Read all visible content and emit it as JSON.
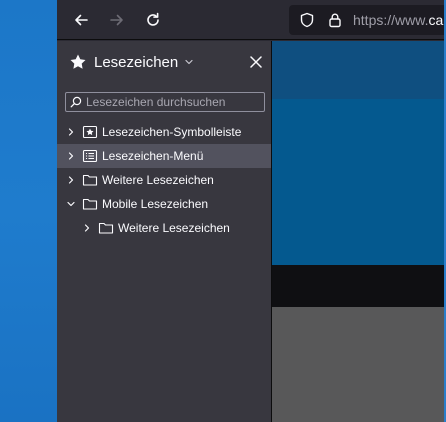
{
  "toolbar": {
    "back_icon": "arrow-left-icon",
    "forward_icon": "arrow-right-icon",
    "reload_icon": "reload-icon",
    "url_prefix": "https://www.",
    "url_domain": "car"
  },
  "sidebar": {
    "title": "Lesezeichen",
    "search_placeholder": "Lesezeichen durchsuchen",
    "items": [
      {
        "label": "Lesezeichen-Symbolleiste",
        "icon": "bookmark-toolbar-icon",
        "expanded": false,
        "depth": 0
      },
      {
        "label": "Lesezeichen-Menü",
        "icon": "bookmark-menu-icon",
        "expanded": false,
        "depth": 0,
        "selected": true
      },
      {
        "label": "Weitere Lesezeichen",
        "icon": "folder-icon",
        "expanded": false,
        "depth": 0
      },
      {
        "label": "Mobile Lesezeichen",
        "icon": "folder-icon",
        "expanded": true,
        "depth": 0
      },
      {
        "label": "Weitere Lesezeichen",
        "icon": "folder-icon",
        "expanded": false,
        "depth": 1
      }
    ]
  },
  "colors": {
    "toolbar_bg": "#2b2a33",
    "sidebar_bg": "#38373f",
    "selected_row": "#52525e",
    "desktop_blue": "#1c77c8"
  }
}
